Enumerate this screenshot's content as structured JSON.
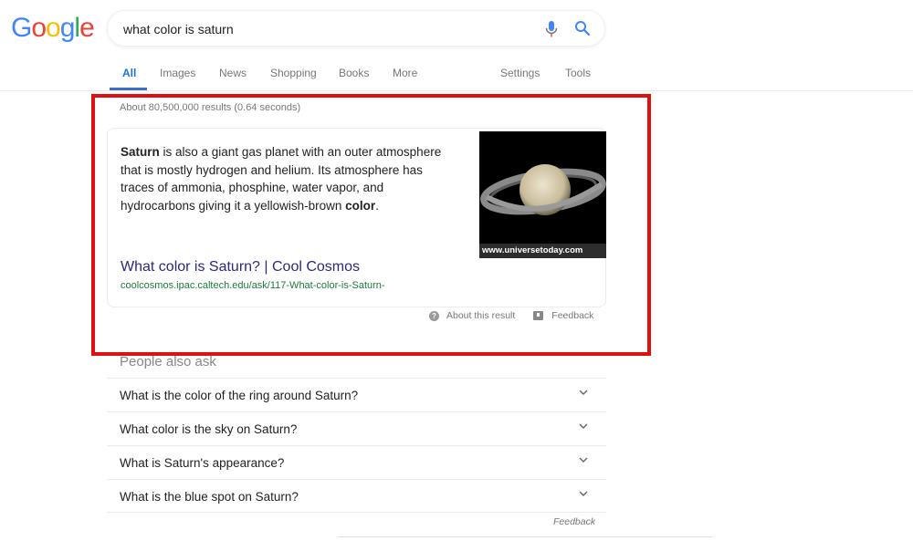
{
  "logo": {
    "letters": [
      "G",
      "o",
      "o",
      "g",
      "l",
      "e"
    ],
    "colors": [
      "#4285f4",
      "#ea4335",
      "#fbbc05",
      "#4285f4",
      "#34a853",
      "#ea4335"
    ]
  },
  "search": {
    "query": "what color is saturn",
    "mic_icon": "mic-icon",
    "search_icon": "search-icon"
  },
  "tabs": {
    "items": [
      {
        "label": "All",
        "active": true
      },
      {
        "label": "Images"
      },
      {
        "label": "News"
      },
      {
        "label": "Shopping"
      },
      {
        "label": "Books"
      },
      {
        "label": "More"
      }
    ],
    "settings": "Settings",
    "tools": "Tools"
  },
  "stats": "About 80,500,000 results (0.64 seconds)",
  "featured_snippet": {
    "text_parts": [
      {
        "bold": true,
        "text": "Saturn"
      },
      {
        "bold": false,
        "text": " is also a giant gas planet with an outer atmosphere that is mostly hydrogen and helium. Its atmosphere has traces of ammonia, phosphine, water vapor, and hydrocarbons giving it a yellowish-brown "
      },
      {
        "bold": true,
        "text": "color"
      },
      {
        "bold": false,
        "text": "."
      }
    ],
    "image_caption": "www.universetoday.com",
    "title": "What color is Saturn? | Cool Cosmos",
    "url": "coolcosmos.ipac.caltech.edu/ask/117-What-color-is-Saturn-",
    "about_label": "About this result",
    "feedback_label": "Feedback"
  },
  "highlight_color": "#e01010",
  "people_also_ask": {
    "title": "People also ask",
    "questions": [
      "What is the color of the ring around Saturn?",
      "What color is the sky on Saturn?",
      "What is Saturn's appearance?",
      "What is the blue spot on Saturn?"
    ],
    "feedback_label": "Feedback"
  }
}
